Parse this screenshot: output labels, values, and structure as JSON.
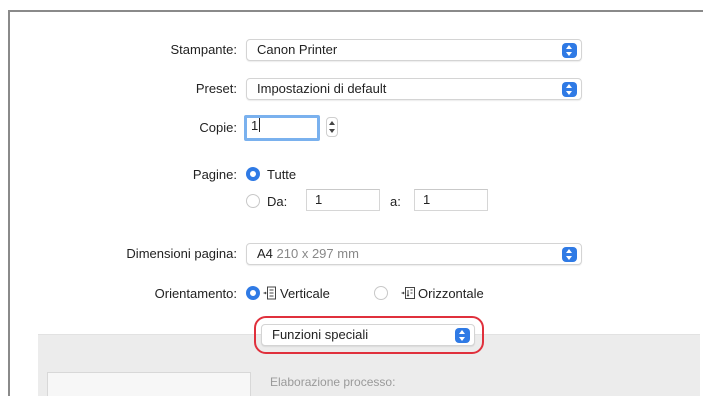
{
  "printer": {
    "label": "Stampante:",
    "value": "Canon Printer"
  },
  "preset": {
    "label": "Preset:",
    "value": "Impostazioni di default"
  },
  "copies": {
    "label": "Copie:",
    "value": "1"
  },
  "pages": {
    "label": "Pagine:",
    "all_label": "Tutte",
    "all_selected": true,
    "from_label": "Da:",
    "from_value": "1",
    "to_label": "a:",
    "to_value": "1"
  },
  "paper_size": {
    "label": "Dimensioni pagina:",
    "name": "A4",
    "dimensions": "210 x 297 mm"
  },
  "orientation": {
    "label": "Orientamento:",
    "options": [
      {
        "label": "Verticale",
        "icon": "portrait-orientation-icon",
        "selected": true
      },
      {
        "label": "Orizzontale",
        "icon": "landscape-orientation-icon",
        "selected": false
      }
    ]
  },
  "section_menu": {
    "value": "Funzioni speciali"
  },
  "section_caption": "Elaborazione processo:",
  "colors": {
    "accent": "#2f7ae5",
    "highlight": "#e0303c",
    "focus_ring": "#7ab1ee"
  }
}
